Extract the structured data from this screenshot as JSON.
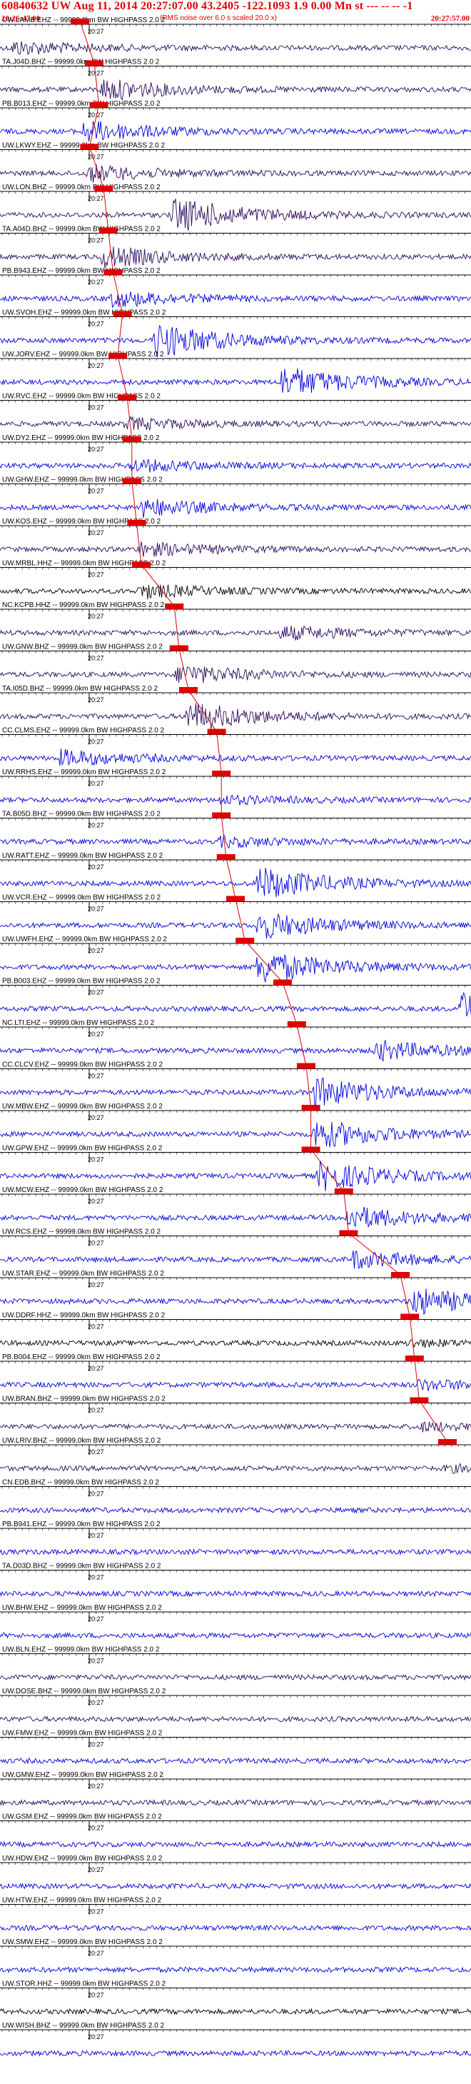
{
  "header": {
    "title": "60840632 UW Aug 11, 2014 20:27:07.00   43.2405 -122.1093  1.9 0.00 Mn st --- -- --  -1",
    "start_time": "20:26:47.00",
    "end_time": "20:27:57.00",
    "rms_note": "(RMS noise over 6.0 s scaled 20.0 x)"
  },
  "colors": {
    "title_red": "#e00000",
    "pick_red": "#e00000",
    "blue": "#0000dd",
    "dark": "#2a0a5e",
    "black": "#000000",
    "tick": "#000000"
  },
  "chart_data": {
    "type": "seismogram",
    "time_range": [
      "20:26:47.00",
      "20:27:57.00"
    ],
    "tick_label": "20:27",
    "filter_text": "99999.0km BW  HIGHPASS  2.0  2",
    "traces": [
      {
        "station": "UW.LAMB.EHZ",
        "color": "dark",
        "p_pick": 0.17,
        "burst": 0.03,
        "amp": 0.35
      },
      {
        "station": "TA.J04D.BHZ",
        "color": "dark",
        "p_pick": 0.2,
        "burst": 0.22,
        "amp": 0.55
      },
      {
        "station": "PB.B013.EHZ",
        "color": "blue",
        "p_pick": 0.21,
        "burst": 0.18,
        "amp": 0.55
      },
      {
        "station": "UW.LKWY.EHZ",
        "color": "dark",
        "p_pick": 0.19,
        "burst": 0.19,
        "amp": 0.4
      },
      {
        "station": "UW.LON.BHZ",
        "color": "dark",
        "p_pick": 0.22,
        "burst": 0.37,
        "amp": 0.9
      },
      {
        "station": "TA.A04D.BHZ",
        "color": "dark",
        "p_pick": 0.23,
        "burst": 0.22,
        "amp": 0.55
      },
      {
        "station": "PB.B943.EHZ",
        "color": "blue",
        "p_pick": 0.24,
        "burst": 0.24,
        "amp": 0.4
      },
      {
        "station": "UW.SVOH.EHZ",
        "color": "blue",
        "p_pick": 0.26,
        "burst": 0.33,
        "amp": 0.9
      },
      {
        "station": "UW.JORV.EHZ",
        "color": "blue",
        "p_pick": 0.25,
        "burst": 0.6,
        "amp": 0.8
      },
      {
        "station": "UW.RVC.EHZ",
        "color": "dark",
        "p_pick": 0.27,
        "burst": 0.27,
        "amp": 0.3
      },
      {
        "station": "UW.DY2.EHZ",
        "color": "blue",
        "p_pick": 0.28,
        "burst": 0.28,
        "amp": 0.3
      },
      {
        "station": "UW.GHW.EHZ",
        "color": "blue",
        "p_pick": 0.28,
        "burst": 0.3,
        "amp": 0.45
      },
      {
        "station": "UW.KOS.EHZ",
        "color": "dark",
        "p_pick": 0.29,
        "burst": 0.3,
        "amp": 0.35
      },
      {
        "station": "UW.MRBL.HHZ",
        "color": "black",
        "p_pick": 0.3,
        "burst": 0.3,
        "amp": 0.35
      },
      {
        "station": "NC.KCPB.HHZ",
        "color": "dark",
        "p_pick": 0.37,
        "burst": 0.6,
        "amp": 0.35
      },
      {
        "station": "UW.GNW.BHZ",
        "color": "dark",
        "p_pick": 0.38,
        "burst": 0.38,
        "amp": 0.5
      },
      {
        "station": "TA.I05D.BHZ",
        "color": "dark",
        "p_pick": 0.4,
        "burst": 0.4,
        "amp": 0.75
      },
      {
        "station": "CC.CLMS.EHZ",
        "color": "blue",
        "p_pick": 0.46,
        "burst": 0.13,
        "amp": 0.4
      },
      {
        "station": "UW.RRHS.EHZ",
        "color": "blue",
        "p_pick": 0.47,
        "burst": 0.47,
        "amp": 0.2
      },
      {
        "station": "TA.B05D.BHZ",
        "color": "blue",
        "p_pick": 0.47,
        "burst": 0.47,
        "amp": 0.25
      },
      {
        "station": "UW.RATT.EHZ",
        "color": "blue",
        "p_pick": 0.48,
        "burst": 0.55,
        "amp": 0.85
      },
      {
        "station": "UW.VCR.EHZ",
        "color": "blue",
        "p_pick": 0.5,
        "burst": 0.55,
        "amp": 0.7
      },
      {
        "station": "UW.UWFH.EHZ",
        "color": "blue",
        "p_pick": 0.52,
        "burst": 0.55,
        "amp": 0.9
      },
      {
        "station": "PB.B003.EHZ",
        "color": "blue",
        "p_pick": 0.6,
        "burst": 0.98,
        "amp": 0.8
      },
      {
        "station": "NC.LTI.EHZ",
        "color": "blue",
        "p_pick": 0.63,
        "burst": 0.8,
        "amp": 0.5
      },
      {
        "station": "CC.CLCV.EHZ",
        "color": "blue",
        "p_pick": 0.65,
        "burst": 0.67,
        "amp": 0.75
      },
      {
        "station": "UW.MBW.EHZ",
        "color": "blue",
        "p_pick": 0.66,
        "burst": 0.67,
        "amp": 0.75
      },
      {
        "station": "UW.GPW.EHZ",
        "color": "blue",
        "p_pick": 0.66,
        "burst": 0.68,
        "amp": 0.75
      },
      {
        "station": "UW.MCW.EHZ",
        "color": "blue",
        "p_pick": 0.73,
        "burst": 0.74,
        "amp": 0.6
      },
      {
        "station": "UW.RCS.EHZ",
        "color": "blue",
        "p_pick": 0.74,
        "burst": 0.75,
        "amp": 0.45
      },
      {
        "station": "UW.STAR.EHZ",
        "color": "blue",
        "p_pick": 0.85,
        "burst": 0.88,
        "amp": 0.7
      },
      {
        "station": "UW.DDRF.HHZ",
        "color": "black",
        "p_pick": 0.87,
        "burst": 0.87,
        "amp": 0.15
      },
      {
        "station": "PB.B004.EHZ",
        "color": "blue",
        "p_pick": 0.88,
        "burst": 0.89,
        "amp": 0.25
      },
      {
        "station": "UW.BRAN.BHZ",
        "color": "dark",
        "p_pick": 0.89,
        "burst": 0.89,
        "amp": 0.2
      },
      {
        "station": "UW.LRIV.BHZ",
        "color": "dark",
        "p_pick": 0.95,
        "burst": 0.95,
        "amp": 0.15
      },
      {
        "station": "CN.EDB.BHZ",
        "color": "blue",
        "p_pick": null,
        "burst": null,
        "amp": 0
      },
      {
        "station": "PB.B941.EHZ",
        "color": "blue",
        "p_pick": null,
        "burst": null,
        "amp": 0
      },
      {
        "station": "TA.D03D.BHZ",
        "color": "blue",
        "p_pick": null,
        "burst": null,
        "amp": 0
      },
      {
        "station": "UW.BHW.EHZ",
        "color": "blue",
        "p_pick": null,
        "burst": null,
        "amp": 0
      },
      {
        "station": "UW.BLN.EHZ",
        "color": "dark",
        "p_pick": null,
        "burst": null,
        "amp": 0
      },
      {
        "station": "UW.DOSE.BHZ",
        "color": "dark",
        "p_pick": null,
        "burst": null,
        "amp": 0
      },
      {
        "station": "UW.FMW.EHZ",
        "color": "blue",
        "p_pick": null,
        "burst": null,
        "amp": 0
      },
      {
        "station": "UW.GMW.EHZ",
        "color": "dark",
        "p_pick": null,
        "burst": null,
        "amp": 0
      },
      {
        "station": "UW.GSM.EHZ",
        "color": "blue",
        "p_pick": null,
        "burst": null,
        "amp": 0
      },
      {
        "station": "UW.HDW.EHZ",
        "color": "blue",
        "p_pick": null,
        "burst": null,
        "amp": 0
      },
      {
        "station": "UW.HTW.EHZ",
        "color": "blue",
        "p_pick": null,
        "burst": null,
        "amp": 0
      },
      {
        "station": "UW.SMW.EHZ",
        "color": "blue",
        "p_pick": null,
        "burst": null,
        "amp": 0
      },
      {
        "station": "UW.STOR.HHZ",
        "color": "black",
        "p_pick": null,
        "burst": null,
        "amp": 0
      },
      {
        "station": "UW.WISH.BHZ",
        "color": "blue",
        "p_pick": null,
        "burst": null,
        "amp": 0
      }
    ]
  }
}
